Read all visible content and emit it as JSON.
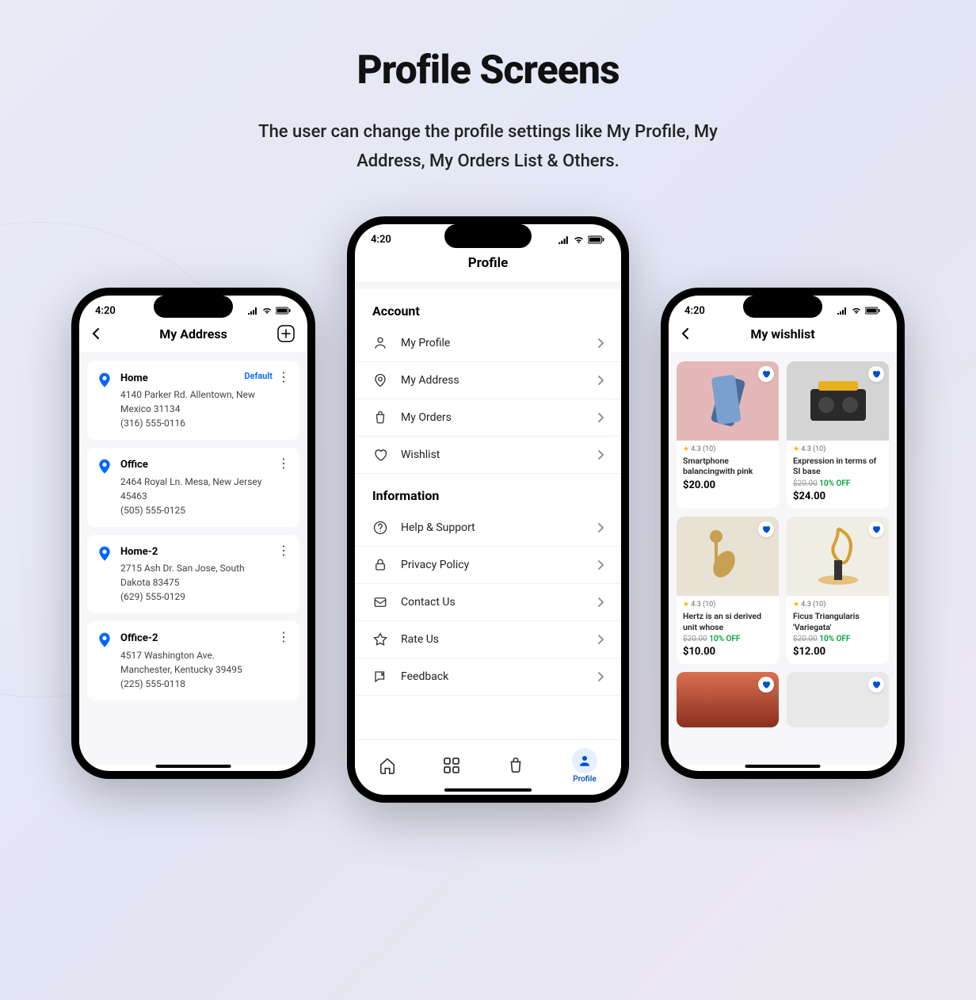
{
  "hero": {
    "title": "Profile Screens",
    "subtitle_l1": "The user can change the profile settings like My Profile, My",
    "subtitle_l2": "Address, My Orders List & Others."
  },
  "status_time": "4:20",
  "address": {
    "title": "My Address",
    "items": [
      {
        "name": "Home",
        "line1": "4140 Parker Rd. Allentown, New",
        "line2": "Mexico 31134",
        "phone": "(316) 555-0116",
        "default": "Default"
      },
      {
        "name": "Office",
        "line1": "2464 Royal Ln. Mesa, New Jersey",
        "line2": "45463",
        "phone": "(505) 555-0125",
        "default": ""
      },
      {
        "name": "Home-2",
        "line1": "2715 Ash Dr. San Jose, South",
        "line2": "Dakota 83475",
        "phone": "(629) 555-0129",
        "default": ""
      },
      {
        "name": "Office-2",
        "line1": "4517 Washington Ave.",
        "line2": "Manchester, Kentucky 39495",
        "phone": "(225) 555-0118",
        "default": ""
      }
    ]
  },
  "profile": {
    "title": "Profile",
    "section1": "Account",
    "section2": "Information",
    "account": [
      {
        "label": "My Profile"
      },
      {
        "label": "My Address"
      },
      {
        "label": "My Orders"
      },
      {
        "label": "Wishlist"
      }
    ],
    "info": [
      {
        "label": "Help & Support"
      },
      {
        "label": "Privacy Policy"
      },
      {
        "label": "Contact Us"
      },
      {
        "label": "Rate Us"
      },
      {
        "label": "Feedback"
      }
    ],
    "nav_profile": "Profile"
  },
  "wishlist": {
    "title": "My wishlist",
    "items": [
      {
        "rating": "4.3 (10)",
        "title": "Smartphone balancingwith pink",
        "old": "",
        "discount": "",
        "price": "$20.00",
        "bg": "#e4b8b8"
      },
      {
        "rating": "4.3 (10)",
        "title": "Expression in terms of SI base",
        "old": "$20.00",
        "discount": "10% OFF",
        "price": "$24.00",
        "bg": "#d4d4d4"
      },
      {
        "rating": "4.3 (10)",
        "title": "Hertz is an si derived unit whose",
        "old": "$20.00",
        "discount": "10% OFF",
        "price": "$10.00",
        "bg": "#e8e2d5"
      },
      {
        "rating": "4.3 (10)",
        "title": "Ficus Triangularis 'Variegata'",
        "old": "$20.00",
        "discount": "10% OFF",
        "price": "$12.00",
        "bg": "#f0ede5"
      }
    ]
  }
}
